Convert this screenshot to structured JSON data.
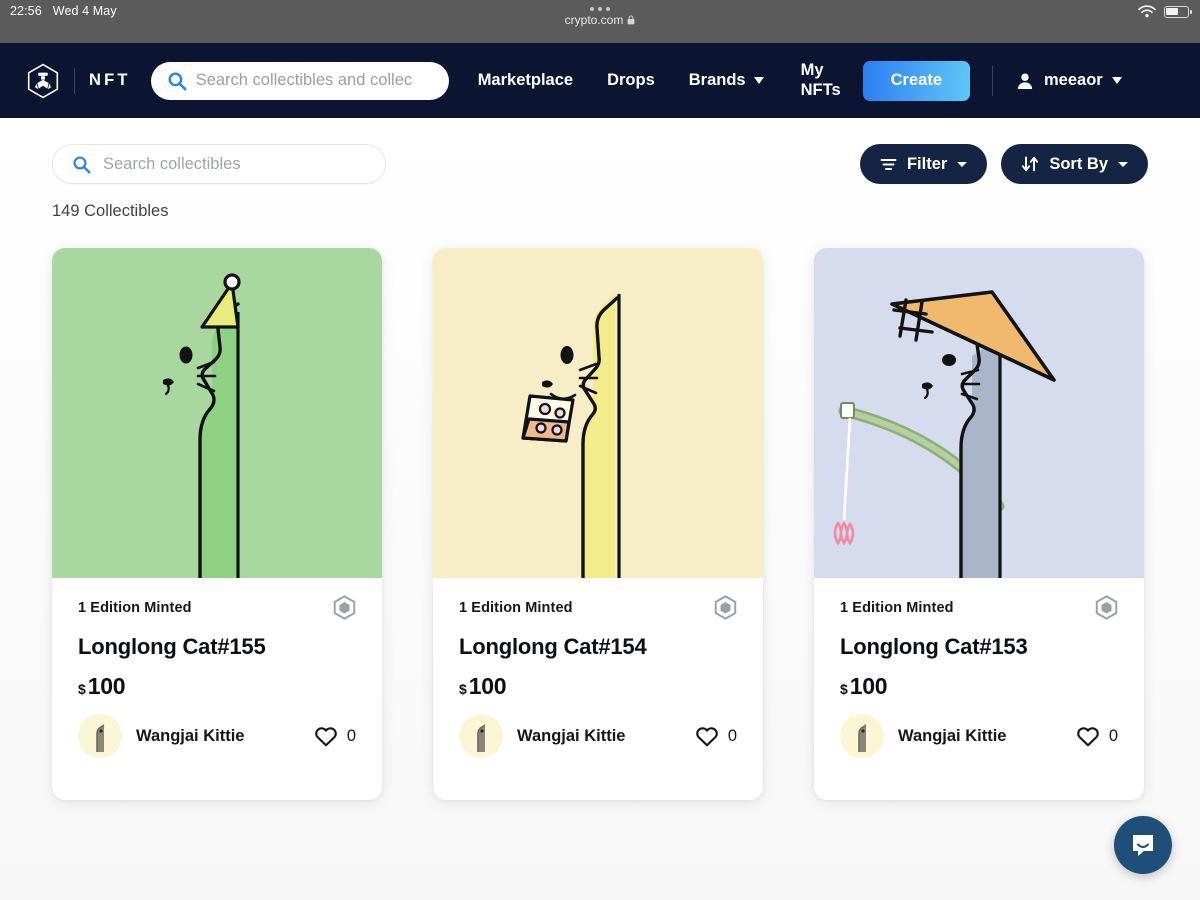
{
  "statusbar": {
    "time": "22:56",
    "date": "Wed 4 May",
    "url": "crypto.com",
    "lock_icon": "lock-icon",
    "wifi_icon": "wifi-icon",
    "battery_icon": "battery-icon",
    "battery_level_pct": 55
  },
  "topnav": {
    "logo_icon": "crypto-com-logo-icon",
    "brand": "NFT",
    "search": {
      "icon": "search-icon",
      "placeholder": "Search collectibles and collec"
    },
    "links": [
      {
        "label": "Marketplace",
        "has_caret": false
      },
      {
        "label": "Drops",
        "has_caret": false
      },
      {
        "label": "Brands",
        "has_caret": true
      }
    ],
    "my_nfts": {
      "line1": "My",
      "line2": "NFTs"
    },
    "create_label": "Create",
    "account": {
      "icon": "person-icon",
      "name": "meeaor",
      "caret_icon": "chevron-down-icon"
    }
  },
  "toolbar": {
    "search": {
      "icon": "search-icon",
      "placeholder": "Search collectibles"
    },
    "filter": {
      "label": "Filter",
      "icon": "filter-icon",
      "caret_icon": "chevron-down-icon"
    },
    "sort": {
      "label": "Sort By",
      "icon": "sort-arrows-icon",
      "caret_icon": "chevron-down-icon"
    }
  },
  "results": {
    "count_label": "149 Collectibles"
  },
  "cards": [
    {
      "edition": "1 Edition Minted",
      "chain_icon": "cronos-chain-icon",
      "title": "Longlong Cat#155",
      "currency": "$",
      "price": "100",
      "creator": "Wangjai Kittie",
      "likes": "0",
      "like_icon": "heart-outline-icon",
      "art": {
        "name": "longlong-cat-green-party-hat",
        "bg": "#a8d8a0",
        "body": "#8fd183",
        "accent": "#e8ec7a",
        "stroke": "#121212"
      }
    },
    {
      "edition": "1 Edition Minted",
      "chain_icon": "cronos-chain-icon",
      "title": "Longlong Cat#154",
      "currency": "$",
      "price": "100",
      "creator": "Wangjai Kittie",
      "likes": "0",
      "like_icon": "heart-outline-icon",
      "art": {
        "name": "longlong-cat-yellow-pizza",
        "bg": "#f7eec7",
        "body": "#f2ec8a",
        "accent": "#f0b98e",
        "stroke": "#121212"
      }
    },
    {
      "edition": "1 Edition Minted",
      "chain_icon": "cronos-chain-icon",
      "title": "Longlong Cat#153",
      "currency": "$",
      "price": "100",
      "creator": "Wangjai Kittie",
      "likes": "0",
      "like_icon": "heart-outline-icon",
      "art": {
        "name": "longlong-cat-blue-straw-hat-fishing",
        "bg": "#d5dced",
        "body": "#a9b6ca",
        "accent": "#f0b96e",
        "stroke": "#121212"
      }
    }
  ],
  "chat": {
    "icon": "chat-bubble-icon",
    "color": "#1f4e79"
  },
  "colors": {
    "nav_bg": "#0b1430",
    "pill_bg": "#152344",
    "accent_blue": "#2c7ef0",
    "search_icon_blue": "#2f80ed"
  }
}
